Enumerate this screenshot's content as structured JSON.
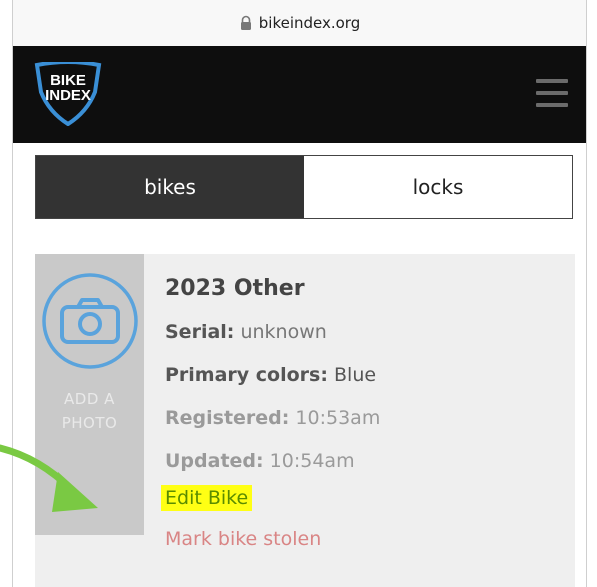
{
  "browser": {
    "url": "bikeindex.org",
    "lock_icon": "lock-icon"
  },
  "header": {
    "logo_line1": "BIKE",
    "logo_line2": "INDEX",
    "menu_icon": "hamburger-menu-icon"
  },
  "tabs": [
    {
      "label": "bikes",
      "active": true
    },
    {
      "label": "locks",
      "active": false
    }
  ],
  "bike": {
    "photo_icon": "camera-icon",
    "add_photo_label": "ADD A\nPHOTO",
    "title": "2023 Other",
    "serial_label": "Serial:",
    "serial_value": "unknown",
    "colors_label": "Primary colors:",
    "colors_value": "Blue",
    "registered_label": "Registered:",
    "registered_value": "10:53am",
    "updated_label": "Updated:",
    "updated_value": "10:54am",
    "edit_link": "Edit Bike",
    "stolen_link": "Mark bike stolen"
  },
  "annotation": {
    "icon": "green-arrow-icon",
    "color": "#7ac943",
    "highlight_color": "#ffff14"
  }
}
